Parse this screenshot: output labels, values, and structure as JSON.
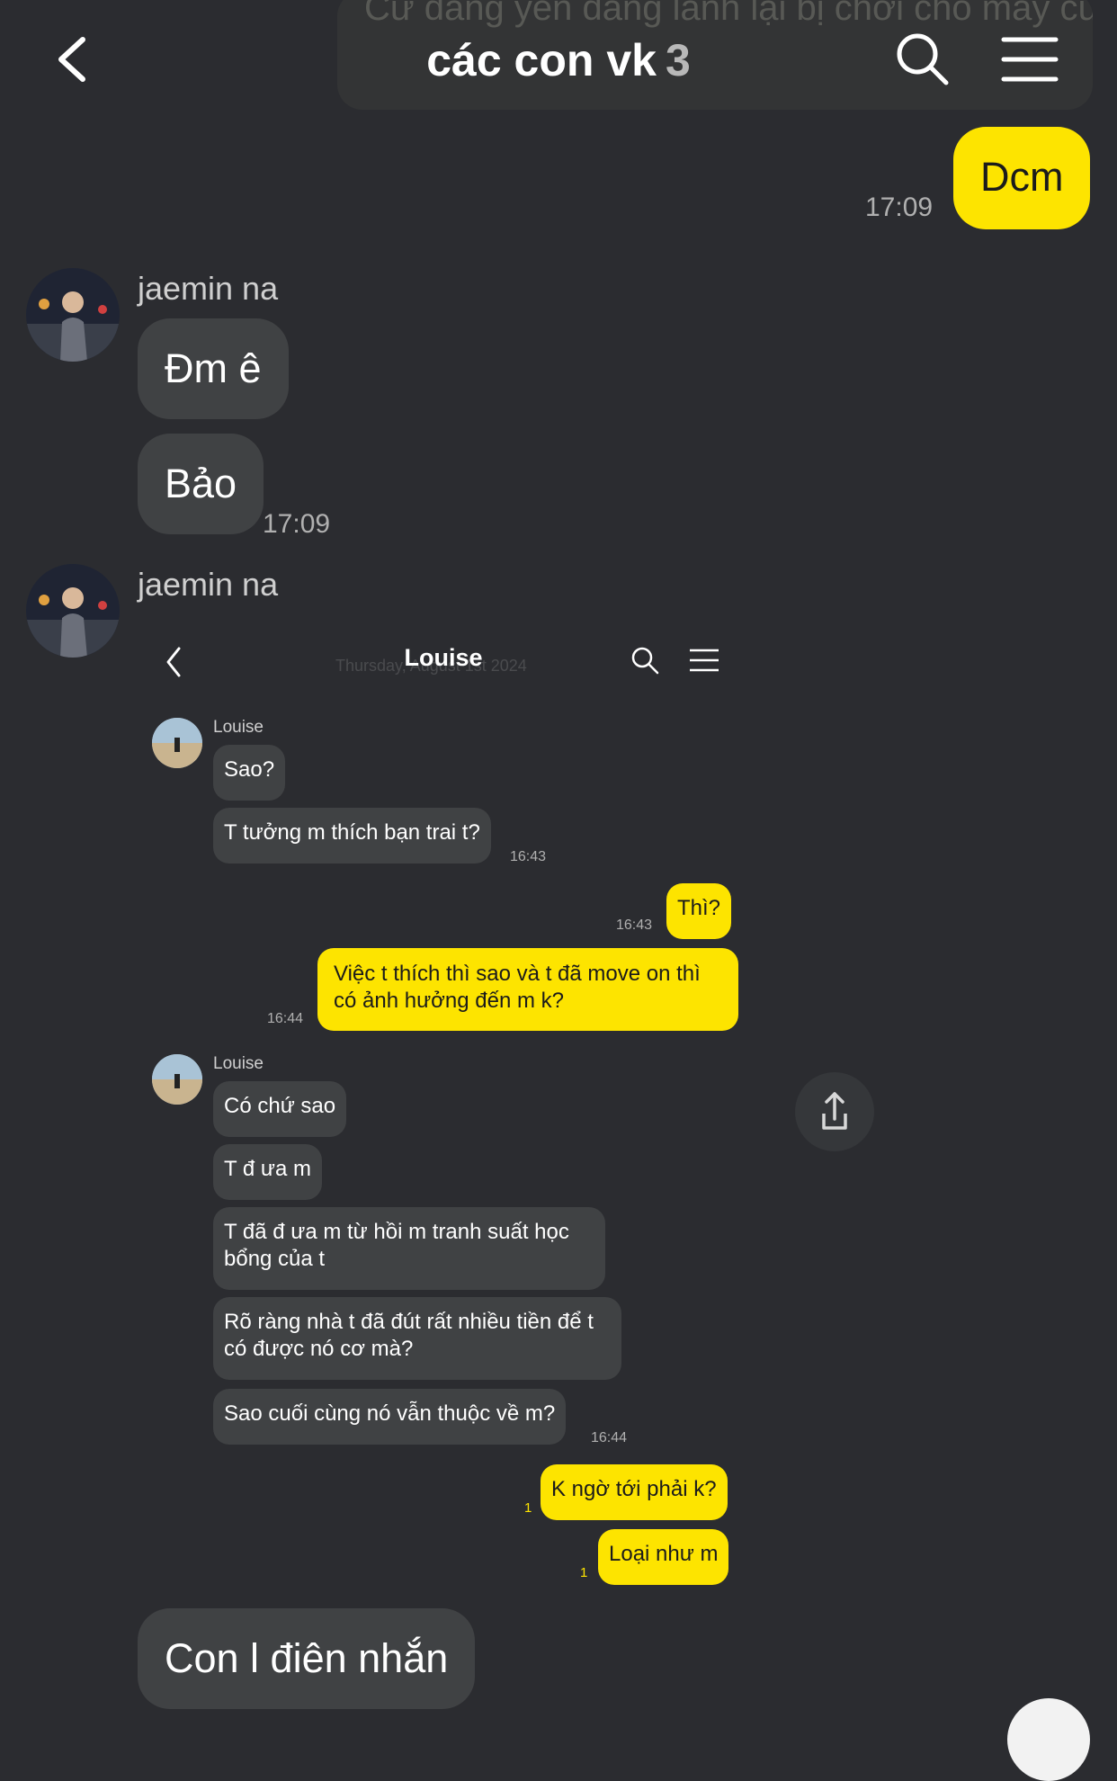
{
  "header": {
    "pinned_preview": "Cứ đang yên đang lành lại bị chơi cho mấy cú",
    "title": "các con vk",
    "member_count": "3"
  },
  "messages": [
    {
      "text": "Dcm",
      "time": "17:09"
    },
    {
      "sender": "jaemin na",
      "text": "Đm ê"
    },
    {
      "text": "Bảo",
      "time": "17:09"
    },
    {
      "sender": "jaemin na"
    },
    {
      "text": "Con l điên nhắn"
    }
  ],
  "screenshot": {
    "title": "Louise",
    "date_ghost": "Thursday, August 1st 2024",
    "sender": "Louise",
    "m1": "Sao?",
    "m2": "T tưởng m thích bạn trai t?",
    "t1": "16:43",
    "m3": "Thì?",
    "t2": "16:43",
    "m4": "Việc t thích thì sao và t đã move on thì có ảnh hưởng đến m k?",
    "t3": "16:44",
    "sender2": "Louise",
    "m5": "Có chứ sao",
    "m6": "T đ ưa m",
    "m7": "T đã đ ưa m từ hồi m tranh suất học bổng của t",
    "m8": "Rõ ràng nhà t đã đút rất nhiều tiền để t có được nó cơ mà?",
    "m9": "Sao cuối cùng nó vẫn thuộc về m?",
    "t4": "16:44",
    "m10": "K ngờ tới phải k?",
    "u1": "1",
    "m11": "Loại như m",
    "u2": "1"
  },
  "colors": {
    "background": "#2b2c30",
    "incoming_bubble": "#404244",
    "outgoing_bubble": "#fde400"
  },
  "icons": [
    "back-icon",
    "search-icon",
    "menu-icon",
    "share-icon"
  ]
}
